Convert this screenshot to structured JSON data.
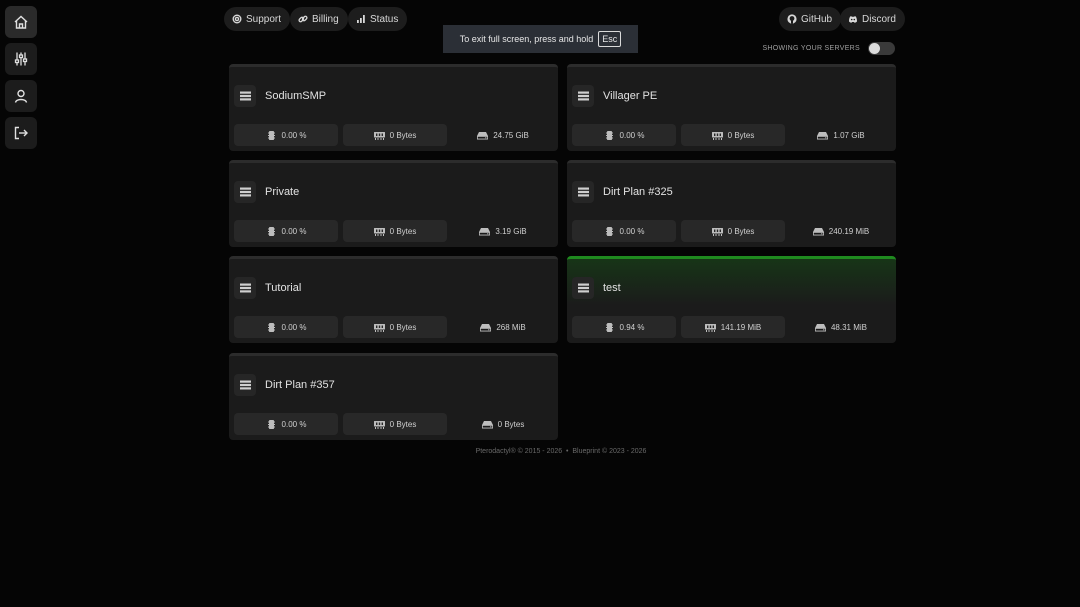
{
  "sidebar": {
    "items": [
      {
        "name": "home",
        "icon": "home-icon"
      },
      {
        "name": "settings",
        "icon": "sliders-icon"
      },
      {
        "name": "account",
        "icon": "user-icon"
      },
      {
        "name": "logout",
        "icon": "sign-out-icon"
      }
    ]
  },
  "nav": {
    "support": "Support",
    "billing": "Billing",
    "status": "Status",
    "github": "GitHub",
    "discord": "Discord"
  },
  "fullscreen_notice": {
    "text": "To exit full screen, press and hold",
    "key": "Esc"
  },
  "toggle": {
    "label": "SHOWING YOUR SERVERS",
    "state": "off"
  },
  "servers": [
    {
      "name": "SodiumSMP",
      "cpu": "0.00 %",
      "memory": "0 Bytes",
      "disk": "24.75 GiB",
      "status": "offline"
    },
    {
      "name": "Villager PE",
      "cpu": "0.00 %",
      "memory": "0 Bytes",
      "disk": "1.07 GiB",
      "status": "offline"
    },
    {
      "name": "Private",
      "cpu": "0.00 %",
      "memory": "0 Bytes",
      "disk": "3.19 GiB",
      "status": "offline"
    },
    {
      "name": "Dirt Plan #325",
      "cpu": "0.00 %",
      "memory": "0 Bytes",
      "disk": "240.19 MiB",
      "status": "offline"
    },
    {
      "name": "Tutorial",
      "cpu": "0.00 %",
      "memory": "0 Bytes",
      "disk": "268 MiB",
      "status": "offline"
    },
    {
      "name": "test",
      "cpu": "0.94 %",
      "memory": "141.19 MiB",
      "disk": "48.31 MiB",
      "status": "running"
    },
    {
      "name": "Dirt Plan #357",
      "cpu": "0.00 %",
      "memory": "0 Bytes",
      "disk": "0 Bytes",
      "status": "offline"
    }
  ],
  "colors": {
    "running": "#1f8a1f",
    "card_bg": "#1b1b1b",
    "page_bg": "#050505"
  },
  "footer": {
    "pterodactyl": "Pterodactyl® © 2015 - 2026",
    "separator": "•",
    "blueprint": "Blueprint © 2023 - 2026"
  }
}
